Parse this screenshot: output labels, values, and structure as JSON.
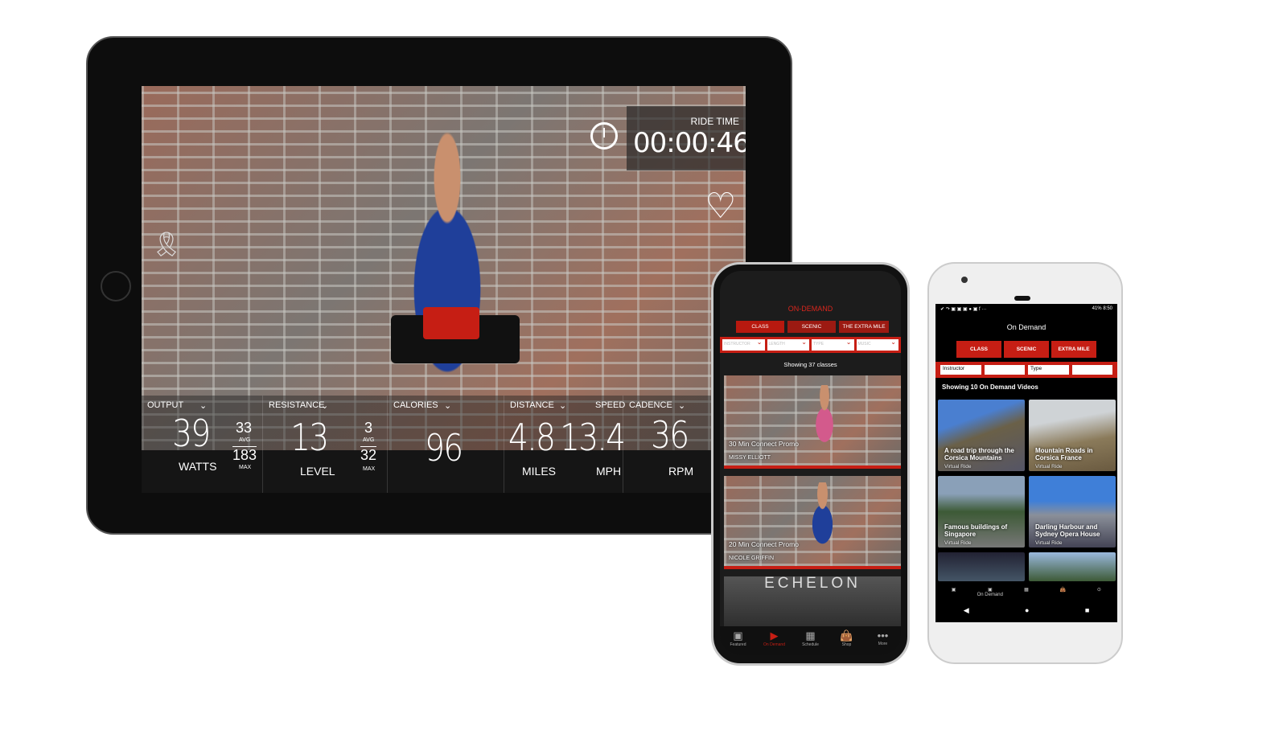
{
  "tablet": {
    "ride_time": {
      "label": "RIDE TIME",
      "value": "00:00:46"
    },
    "stats": [
      {
        "label": "OUTPUT",
        "value": "39",
        "unit": "WATTS",
        "avg": "33",
        "avg_label": "AVG",
        "max": "183",
        "max_label": "MAX"
      },
      {
        "label": "RESISTANCE",
        "value": "13",
        "unit": "LEVEL",
        "avg": "3",
        "avg_label": "AVG",
        "max": "32",
        "max_label": "MAX"
      },
      {
        "label": "CALORIES",
        "value": "96"
      },
      {
        "label": "DISTANCE",
        "value": "4.8",
        "unit": "MILES"
      },
      {
        "label": "SPEED",
        "value": "13.4",
        "unit": "MPH"
      },
      {
        "label": "CADENCE",
        "value": "36",
        "unit": "RPM"
      }
    ]
  },
  "iphone": {
    "title": "ON-DEMAND",
    "tabs": [
      "CLASS",
      "SCENIC",
      "THE EXTRA MILE"
    ],
    "filters": [
      "INSTRUCTOR",
      "LENGTH",
      "TYPE",
      "MUSIC"
    ],
    "count": "Showing 37 classes",
    "classes": [
      {
        "title": "30 Min Connect Promo",
        "instructor": "MISSY ELLIOTT"
      },
      {
        "title": "20 Min Connect Promo",
        "instructor": "NICOLE GRIFFIN"
      }
    ],
    "banner": "ECHELON",
    "nav": [
      "Featured",
      "On Demand",
      "Schedule",
      "Shop",
      "More"
    ],
    "accent": "#c61e14"
  },
  "android": {
    "status": {
      "battery": "41%",
      "time": "8:50"
    },
    "title": "On Demand",
    "tabs": [
      "CLASS",
      "SCENIC",
      "EXTRA MILE"
    ],
    "filters": [
      "Instructor",
      "",
      "Type",
      ""
    ],
    "count": "Showing 10 On Demand Videos",
    "videos": [
      {
        "title": "A road trip through the Corsica Mountains",
        "type": "Virtual Ride"
      },
      {
        "title": "Mountain Roads in Corsica France",
        "type": "Virtual Ride"
      },
      {
        "title": "Famous buildings of Singapore",
        "type": "Virtual Ride"
      },
      {
        "title": "Darling Harbour and Sydney Opera House",
        "type": "Virtual Ride"
      }
    ],
    "nav_active": "On Demand"
  }
}
